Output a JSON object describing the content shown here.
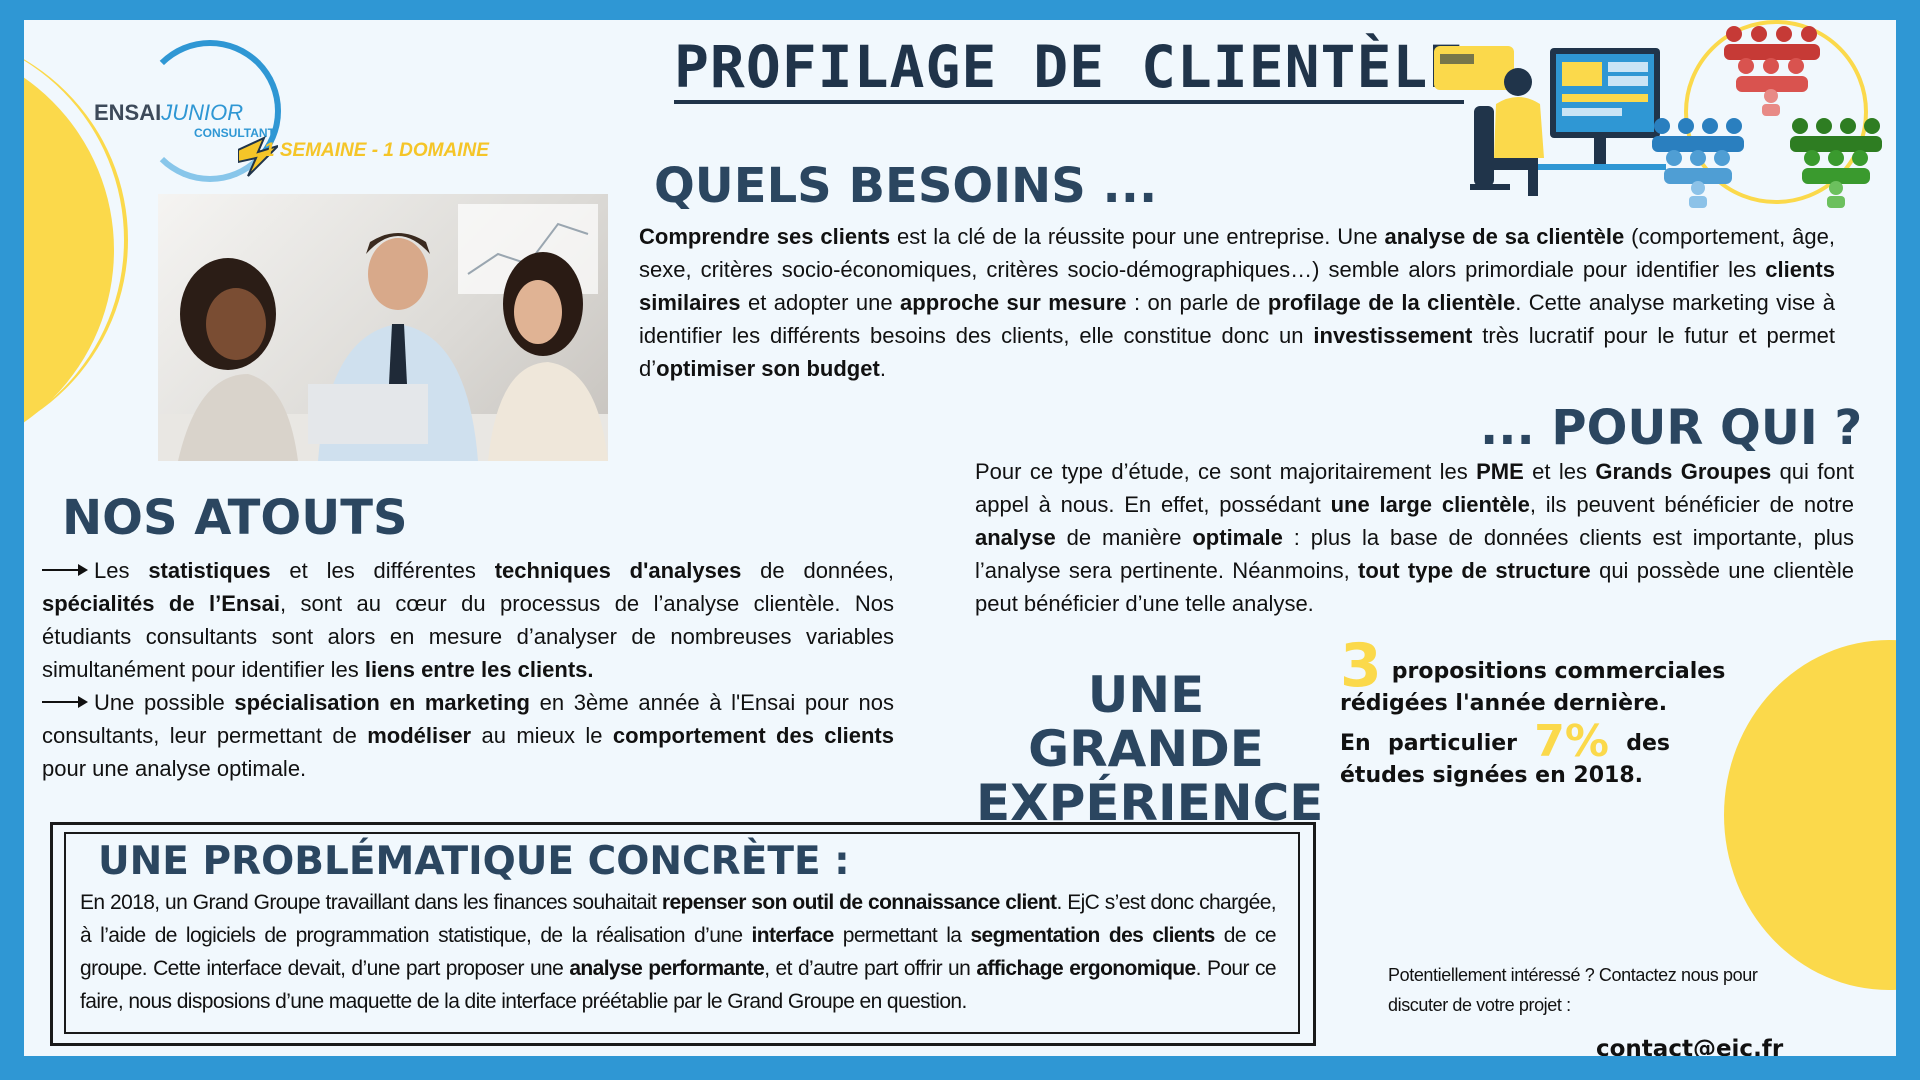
{
  "header": {
    "title": "PROFILAGE DE CLIENTÈLE",
    "logo_brand": "ENSAI",
    "logo_brand_italic": "JUNIOR",
    "logo_sub": "CONSULTANT",
    "tagline": "1 SEMAINE - 1 DOMAINE"
  },
  "besoins": {
    "title": "QUELS BESOINS ...",
    "body_html": "<b>Comprendre ses clients</b> est la clé de la réussite pour une entreprise. Une <b>analyse de sa clientèle</b> (comportement, âge, sexe, critères socio-économiques, critères socio-démographiques…) semble alors primordiale pour identifier les <b>clients similaires</b> et adopter une <b>approche sur mesure</b> : on parle de <b>profilage de la clientèle</b>. Cette analyse marketing vise à identifier les différents besoins des clients, elle constitue donc un <b>investissement</b> très lucratif pour le futur et permet d’<b>optimiser son budget</b>."
  },
  "pour_qui": {
    "title": "... POUR QUI ?",
    "body_html": "Pour ce type d’étude, ce sont majoritairement les <b>PME</b> et les <b>Grands Groupes</b> qui font appel à nous. En effet, possédant <b>une large clientèle</b>, ils peuvent bénéficier de notre <b>analyse</b> de manière <b>optimale</b> : plus la base de données clients est importante, plus l’analyse sera pertinente. Néanmoins, <b>tout type de structure</b> qui possède une clientèle peut bénéficier d’une telle analyse."
  },
  "atouts": {
    "title": "NOS ATOUTS",
    "item1_html": "Les <b>statistiques</b> et les différentes <b>techniques d'analyses</b> de données, <b>spécialités de l’Ensai</b>, sont au cœur du processus de l’analyse clientèle. Nos étudiants consultants sont alors en mesure d’analyser de nombreuses variables simultanément pour identifier les <b>liens entre les clients.</b>",
    "item2_html": "Une possible <b>spécialisation en marketing</b> en 3ème année à l'Ensai pour nos consultants, leur permettant de <b>modéliser</b> au mieux le <b>comportement des clients</b> pour une analyse optimale."
  },
  "experience": {
    "title_line1": "UNE GRANDE",
    "title_line2": "EXPÉRIENCE",
    "stat1_value": "3",
    "stat1_text": "propositions commerciales rédigées l'année dernière.",
    "stat2_prefix": "En particulier",
    "stat2_value": "7%",
    "stat2_suffix": "des études signées en 2018."
  },
  "problematique": {
    "title": "UNE PROBLÉMATIQUE CONCRÈTE :",
    "body_html": "En 2018, un Grand Groupe travaillant dans les finances souhaitait <b>repenser son outil de connaissance client</b>. EjC s’est donc chargée, à l’aide de logiciels de programmation statistique, de la réalisation d’une <b>interface</b> permettant la <b>segmentation des clients</b> de ce groupe. Cette interface devait, d’une part proposer une <b>analyse performante</b>, et d’autre part offrir un <b>affichage ergonomique</b>. Pour ce faire, nous disposions d’une maquette de la dite interface préétablie par le Grand Groupe en question."
  },
  "contact": {
    "text": "Potentiellement intéressé ? Contactez nous pour discuter de votre projet :",
    "email": "contact@ejc.fr"
  },
  "colors": {
    "frame": "#2f97d4",
    "background": "#f1f8fd",
    "accent_yellow": "#fbd94b",
    "heading_navy": "#2b4660",
    "people_red": "#c63a36",
    "people_blue": "#2a7fbf",
    "people_green": "#3a9a2e"
  },
  "icons": [
    "lightning-bolt-icon",
    "person-at-computer-illustration",
    "people-group-red-icon",
    "people-group-blue-icon",
    "people-group-green-icon"
  ]
}
